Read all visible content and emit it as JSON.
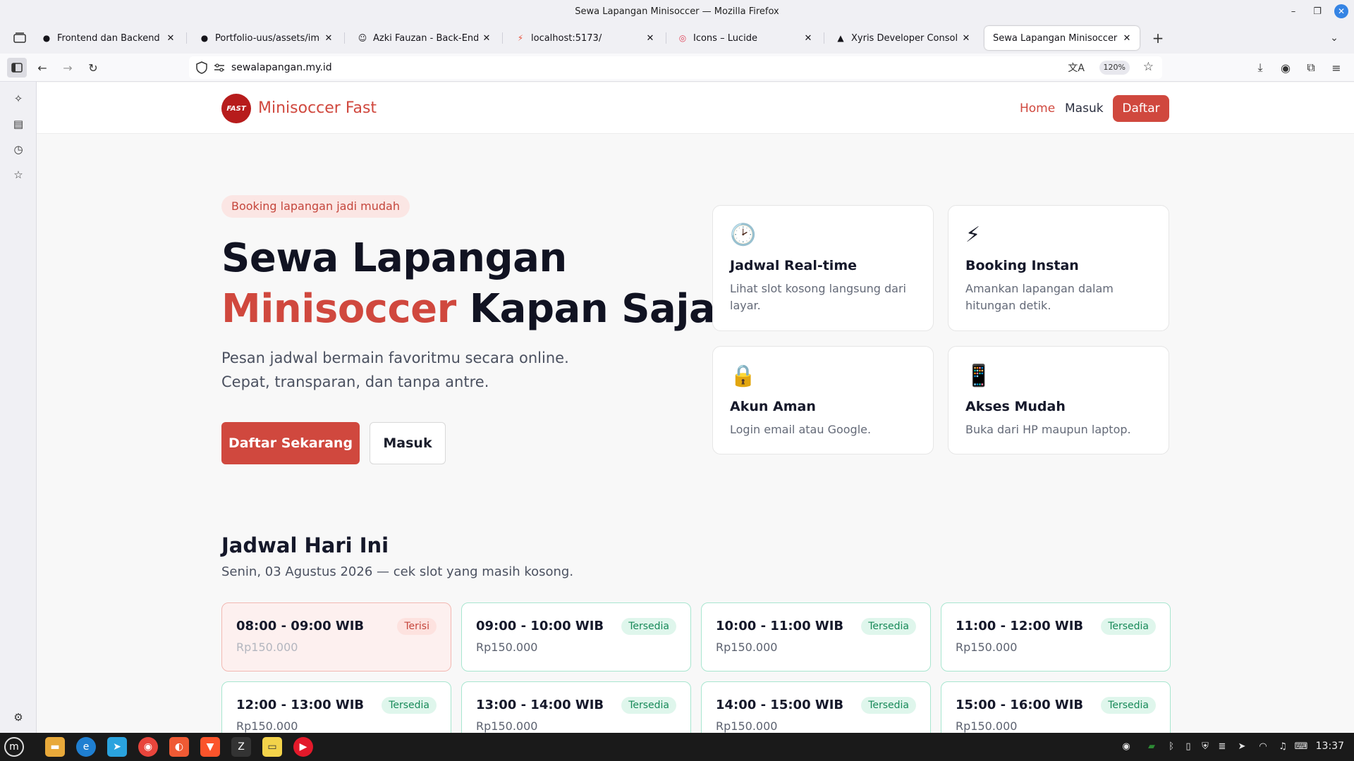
{
  "window": {
    "title": "Sewa Lapangan Minisoccer — Mozilla Firefox"
  },
  "tabs": [
    {
      "label": "Frontend dan Backend Lokal",
      "icon": "github-icon"
    },
    {
      "label": "Portfolio-uus/assets/img/pr",
      "icon": "github-icon"
    },
    {
      "label": "Azki Fauzan - Back-End Deve",
      "icon": "person-icon"
    },
    {
      "label": "localhost:5173/",
      "icon": "vite-icon"
    },
    {
      "label": "Icons – Lucide",
      "icon": "lucide-icon"
    },
    {
      "label": "Xyris Developer Console",
      "icon": "xyris-icon"
    },
    {
      "label": "Sewa Lapangan Minisoccer",
      "icon": "",
      "active": true
    }
  ],
  "navbar": {
    "url": "sewalapangan.my.id",
    "zoom": "120%"
  },
  "site": {
    "logo_text": "FAST",
    "brand": "Minisoccer Fast",
    "nav": {
      "home": "Home",
      "login": "Masuk",
      "register": "Daftar"
    }
  },
  "hero": {
    "badge": "Booking lapangan jadi mudah",
    "title_line1": "Sewa Lapangan",
    "title_accent": "Minisoccer",
    "title_rest": " Kapan Saja",
    "subtitle": "Pesan jadwal bermain favoritmu secara online. Cepat, transparan, dan tanpa antre.",
    "cta_primary": "Daftar Sekarang",
    "cta_secondary": "Masuk"
  },
  "features": [
    {
      "icon": "🕑",
      "title": "Jadwal Real-time",
      "desc": "Lihat slot kosong langsung dari layar."
    },
    {
      "icon": "⚡",
      "title": "Booking Instan",
      "desc": "Amankan lapangan dalam hitungan detik."
    },
    {
      "icon": "🔒",
      "title": "Akun Aman",
      "desc": "Login email atau Google."
    },
    {
      "icon": "📱",
      "title": "Akses Mudah",
      "desc": "Buka dari HP maupun laptop."
    }
  ],
  "schedule": {
    "title": "Jadwal Hari Ini",
    "subtitle": "Senin, 03 Agustus 2026 — cek slot yang masih kosong.",
    "slots": [
      {
        "time": "08:00 - 09:00 WIB",
        "status": "Terisi",
        "price": "Rp150.000",
        "taken": true
      },
      {
        "time": "09:00 - 10:00 WIB",
        "status": "Tersedia",
        "price": "Rp150.000",
        "taken": false
      },
      {
        "time": "10:00 - 11:00 WIB",
        "status": "Tersedia",
        "price": "Rp150.000",
        "taken": false
      },
      {
        "time": "11:00 - 12:00 WIB",
        "status": "Tersedia",
        "price": "Rp150.000",
        "taken": false
      },
      {
        "time": "12:00 - 13:00 WIB",
        "status": "Tersedia",
        "price": "Rp150.000",
        "taken": false
      },
      {
        "time": "13:00 - 14:00 WIB",
        "status": "Tersedia",
        "price": "Rp150.000",
        "taken": false
      },
      {
        "time": "14:00 - 15:00 WIB",
        "status": "Tersedia",
        "price": "Rp150.000",
        "taken": false
      },
      {
        "time": "15:00 - 16:00 WIB",
        "status": "Tersedia",
        "price": "Rp150.000",
        "taken": false
      }
    ]
  },
  "taskbar": {
    "clock": "13:37"
  },
  "colors": {
    "accent": "#d0483e",
    "available_badge_bg": "#dff6ec",
    "available_badge_text": "#188a59",
    "taken_bg": "#fdf0ef"
  }
}
